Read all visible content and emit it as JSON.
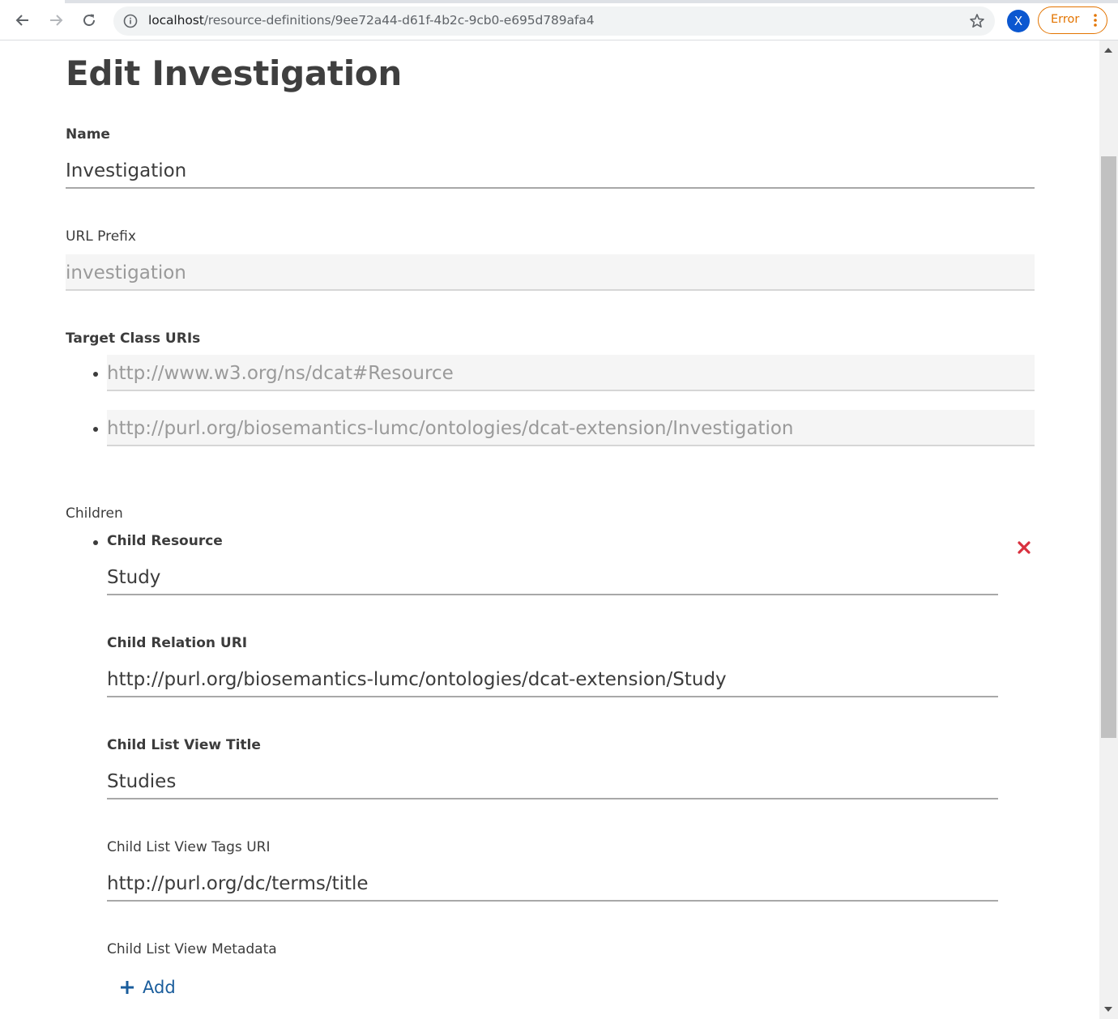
{
  "browser": {
    "url_host": "localhost",
    "url_path": "/resource-definitions/9ee72a44-d61f-4b2c-9cb0-e695d789afa4",
    "profile_initial": "X",
    "error_label": "Error",
    "icons": [
      "back-arrow-icon",
      "forward-arrow-icon",
      "reload-icon",
      "info-icon",
      "star-icon",
      "more-vert-icon"
    ]
  },
  "page": {
    "title": "Edit Investigation"
  },
  "form": {
    "name": {
      "label": "Name",
      "value": "Investigation"
    },
    "url_prefix": {
      "label": "URL Prefix",
      "value": "investigation"
    },
    "target_class_uris": {
      "label": "Target Class URIs",
      "items": [
        "http://www.w3.org/ns/dcat#Resource",
        "http://purl.org/biosemantics-lumc/ontologies/dcat-extension/Investigation"
      ]
    },
    "children": {
      "label": "Children",
      "items": [
        {
          "child_resource_label": "Child Resource",
          "child_resource_value": "Study",
          "relation_uri_label": "Child Relation URI",
          "relation_uri_value": "http://purl.org/biosemantics-lumc/ontologies/dcat-extension/Study",
          "list_view_title_label": "Child List View Title",
          "list_view_title_value": "Studies",
          "list_view_tags_uri_label": "Child List View Tags URI",
          "list_view_tags_uri_value": "http://purl.org/dc/terms/title",
          "list_view_metadata_label": "Child List View Metadata",
          "add_label": "Add"
        }
      ]
    }
  },
  "colors": {
    "remove": "#d9303e",
    "add": "#1a5d9c",
    "error": "#e37400",
    "profile": "#0b57d0"
  }
}
